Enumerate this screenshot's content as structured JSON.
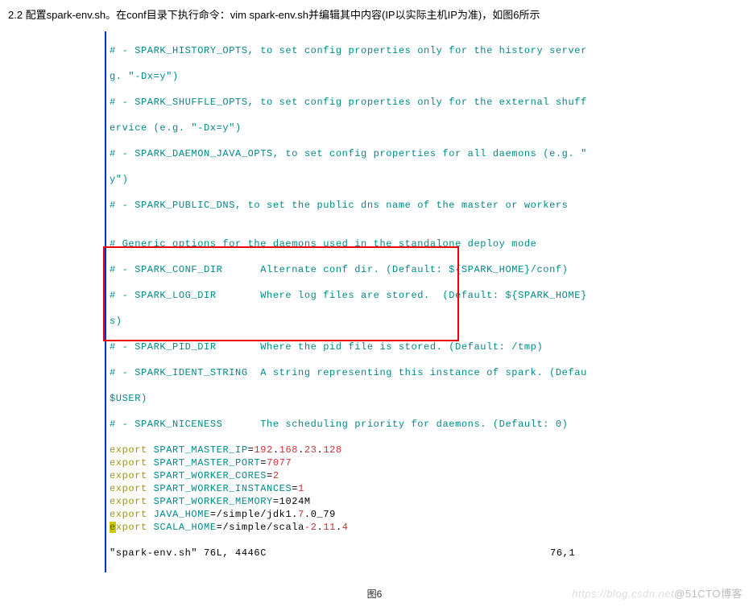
{
  "instruction": "2.2 配置spark-env.sh。在conf目录下执行命令：vim spark-env.sh并编辑其中内容(IP以实际主机IP为准)，如图6所示",
  "code": {
    "c01": "# - SPARK_HISTORY_OPTS, to set config properties only for the history server",
    "c02": "g. \"-Dx=y\")",
    "c03": "# - SPARK_SHUFFLE_OPTS, to set config properties only for the external shuff",
    "c04": "ervice (e.g. \"-Dx=y\")",
    "c05": "# - SPARK_DAEMON_JAVA_OPTS, to set config properties for all daemons (e.g. \"",
    "c06": "y\")",
    "c07": "# - SPARK_PUBLIC_DNS, to set the public dns name of the master or workers",
    "c08": "",
    "c09": "# Generic options for the daemons used in the standalone deploy mode",
    "c10": "# - SPARK_CONF_DIR      Alternate conf dir. (Default: ${SPARK_HOME}/conf)",
    "c11": "# - SPARK_LOG_DIR       Where log files are stored.  (Default: ${SPARK_HOME}",
    "c12": "s)",
    "c13": "# - SPARK_PID_DIR       Where the pid file is stored. (Default: /tmp)",
    "c14": "# - SPARK_IDENT_STRING  A string representing this instance of spark. (Defau",
    "c15": "$USER)",
    "c16": "# - SPARK_NICENESS      The scheduling priority for daemons. (Default: 0)"
  },
  "exports": [
    {
      "kw": "export",
      "sp": " ",
      "var": "SPART_MASTER_IP",
      "eq": "=",
      "val": [
        {
          "t": "192",
          "c": "num-red"
        },
        {
          "t": ".",
          "c": "dot-black"
        },
        {
          "t": "168",
          "c": "num-red"
        },
        {
          "t": ".",
          "c": "dot-black"
        },
        {
          "t": "23",
          "c": "num-red"
        },
        {
          "t": ".",
          "c": "dot-black"
        },
        {
          "t": "128",
          "c": "num-red"
        }
      ]
    },
    {
      "kw": "export",
      "sp": " ",
      "var": "SPART_MASTER_PORT",
      "eq": "=",
      "val": [
        {
          "t": "7077",
          "c": "num-red"
        }
      ]
    },
    {
      "kw": "export",
      "sp": " ",
      "var": "SPART_WORKER_CORES",
      "eq": "=",
      "val": [
        {
          "t": "2",
          "c": "num-red"
        }
      ]
    },
    {
      "kw": "export",
      "sp": " ",
      "var": "SPART_WORKER_INSTANCES",
      "eq": "=",
      "val": [
        {
          "t": "1",
          "c": "num-red"
        }
      ]
    },
    {
      "kw": "export",
      "sp": " ",
      "var": "SPART_WORKER_MEMORY",
      "eq": "=",
      "val": [
        {
          "t": "1024M",
          "c": "text-black"
        }
      ]
    },
    {
      "kw": "export",
      "sp": " ",
      "var": "JAVA_HOME",
      "eq": "=",
      "val": [
        {
          "t": "/simple/jdk1",
          "c": "path-black"
        },
        {
          "t": ".",
          "c": "dot-black"
        },
        {
          "t": "7",
          "c": "num-red"
        },
        {
          "t": ".",
          "c": "dot-black"
        },
        {
          "t": "0",
          "c": "text-black"
        },
        {
          "t": "_79",
          "c": "text-black"
        }
      ]
    },
    {
      "kw_hl": "e",
      "kw_rest": "xport",
      "sp": " ",
      "var": "SCALA_HOME",
      "eq": "=",
      "val": [
        {
          "t": "/simple/scala",
          "c": "path-black"
        },
        {
          "t": "-",
          "c": "num-red"
        },
        {
          "t": "2",
          "c": "num-red"
        },
        {
          "t": ".",
          "c": "dot-black"
        },
        {
          "t": "11",
          "c": "num-red"
        },
        {
          "t": ".",
          "c": "dot-black"
        },
        {
          "t": "4",
          "c": "num-red"
        }
      ]
    }
  ],
  "status": {
    "left": "\"spark-env.sh\" 76L, 4446C",
    "right": "76,1"
  },
  "caption": "图6",
  "watermark": {
    "faint": "https://blog.csdn.net",
    "main": "@51CTO博客"
  }
}
